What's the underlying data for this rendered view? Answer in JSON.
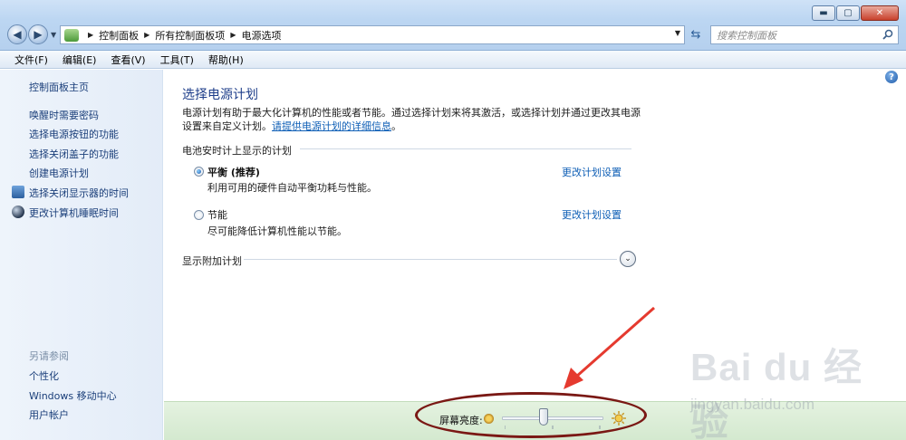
{
  "window": {
    "controls": {
      "minimize": "▬",
      "maximize": "▢",
      "close": "✕"
    }
  },
  "addressbar": {
    "crumbs": [
      "控制面板",
      "所有控制面板项",
      "电源选项"
    ]
  },
  "search": {
    "placeholder": "搜索控制面板"
  },
  "menu": [
    "文件(F)",
    "编辑(E)",
    "查看(V)",
    "工具(T)",
    "帮助(H)"
  ],
  "sidebar": {
    "home": "控制面板主页",
    "items": [
      {
        "label": "唤醒时需要密码",
        "icon": null
      },
      {
        "label": "选择电源按钮的功能",
        "icon": null
      },
      {
        "label": "选择关闭盖子的功能",
        "icon": null
      },
      {
        "label": "创建电源计划",
        "icon": null
      },
      {
        "label": "选择关闭显示器的时间",
        "icon": "monitor-icon"
      },
      {
        "label": "更改计算机睡眠时间",
        "icon": "moon-icon"
      }
    ],
    "see_also": {
      "title": "另请参阅",
      "items": [
        "个性化",
        "Windows 移动中心",
        "用户帐户"
      ]
    }
  },
  "main": {
    "title": "选择电源计划",
    "description": "电源计划有助于最大化计算机的性能或者节能。通过选择计划来将其激活，或选择计划并通过更改其电源设置来自定义计划。",
    "description_link": "请提供电源计划的详细信息",
    "description_end": "。",
    "group_label": "电池安时计上显示的计划",
    "plans": [
      {
        "name": "平衡 (推荐)",
        "desc": "利用可用的硬件自动平衡功耗与性能。",
        "selected": true,
        "link": "更改计划设置"
      },
      {
        "name": "节能",
        "desc": "尽可能降低计算机性能以节能。",
        "selected": false,
        "link": "更改计划设置"
      }
    ],
    "more_plans": "显示附加计划"
  },
  "brightness": {
    "label": "屏幕亮度:",
    "level_percent": 40
  },
  "watermark": {
    "line1": "Bai du 经验",
    "line2": "jingyan.baidu.com"
  },
  "colors": {
    "link": "#1b3f7a",
    "title": "#1e3e8a",
    "annotation": "#7a1814"
  }
}
